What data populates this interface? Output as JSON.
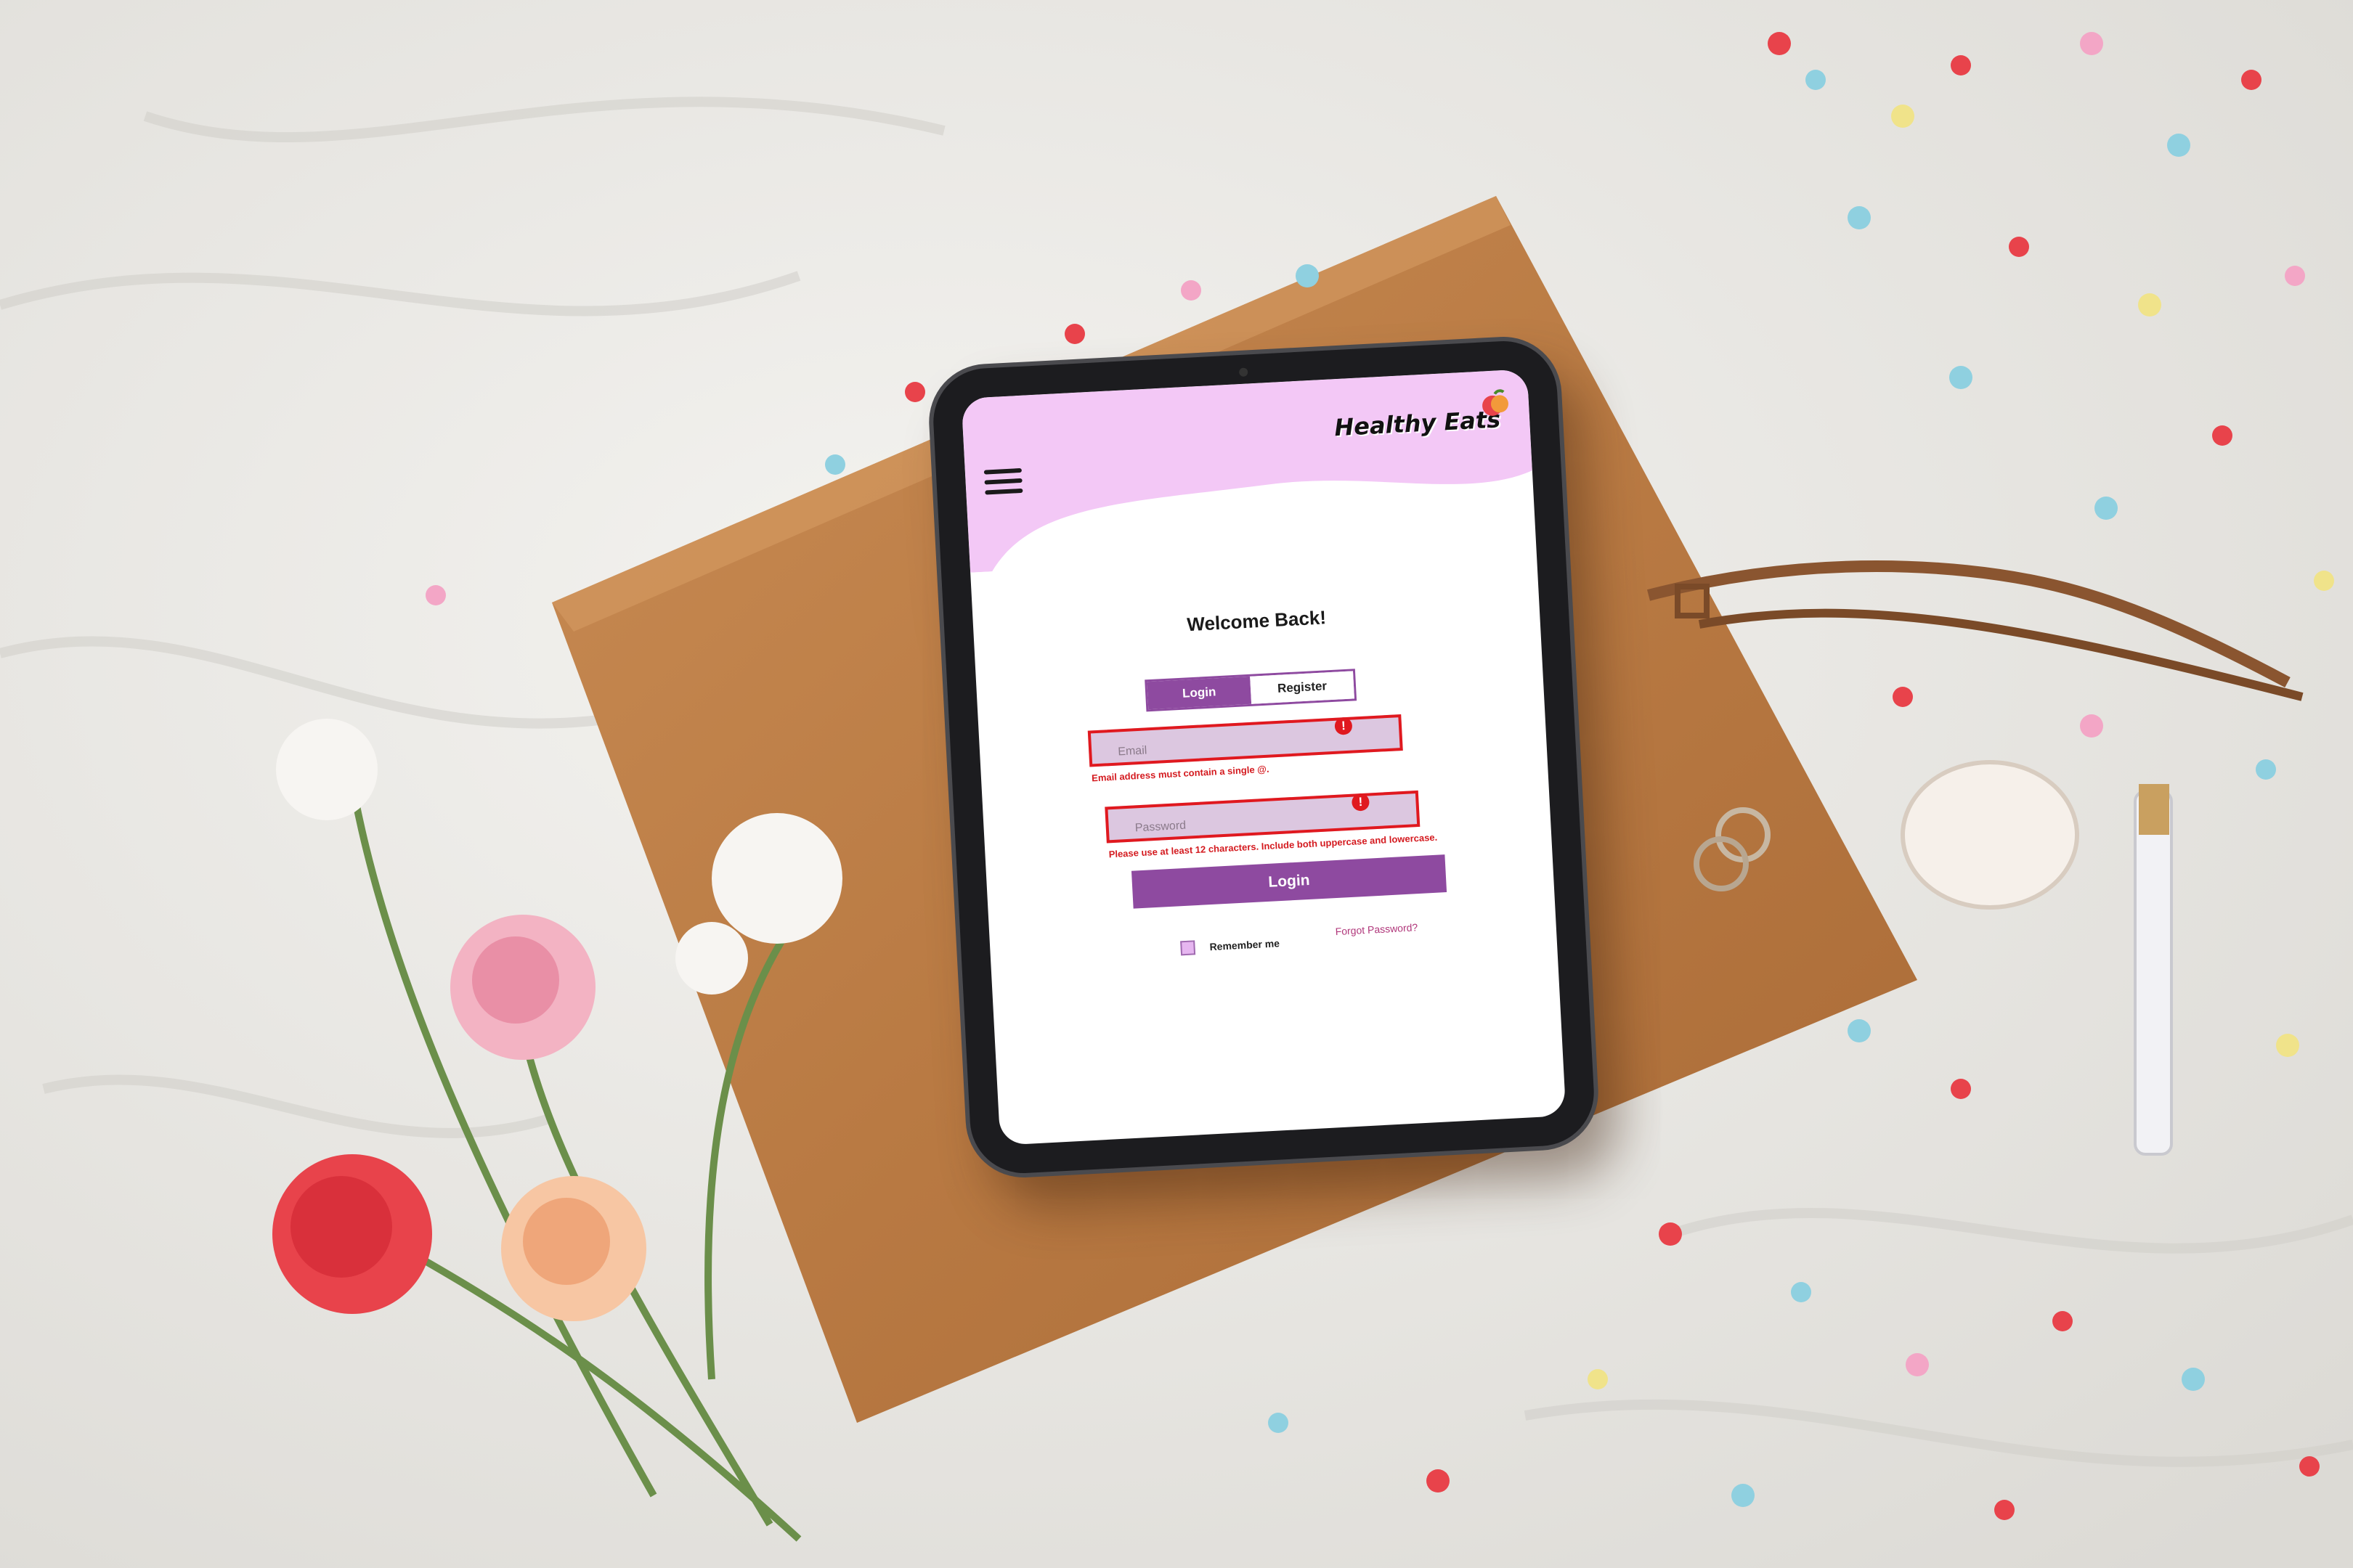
{
  "colors": {
    "accent": "#8e4aa0",
    "header_pink": "#f3c8f6",
    "error": "#e0191f",
    "field_bg": "#dcc7e0"
  },
  "header": {
    "logo_text": "Healthy Eats",
    "menu_icon": "hamburger-menu-icon"
  },
  "login": {
    "welcome": "Welcome Back!",
    "tabs": [
      {
        "label": "Login",
        "active": true
      },
      {
        "label": "Register",
        "active": false
      }
    ],
    "email": {
      "placeholder": "Email",
      "value": "",
      "error": "Email address must contain a single @."
    },
    "password": {
      "placeholder": "Password",
      "value": "",
      "error": "Please use at least 12 characters. Include both uppercase and lowercase."
    },
    "error_icon": "!",
    "submit_label": "Login",
    "remember_label": "Remember me",
    "forgot_label": "Forgot Password?"
  }
}
